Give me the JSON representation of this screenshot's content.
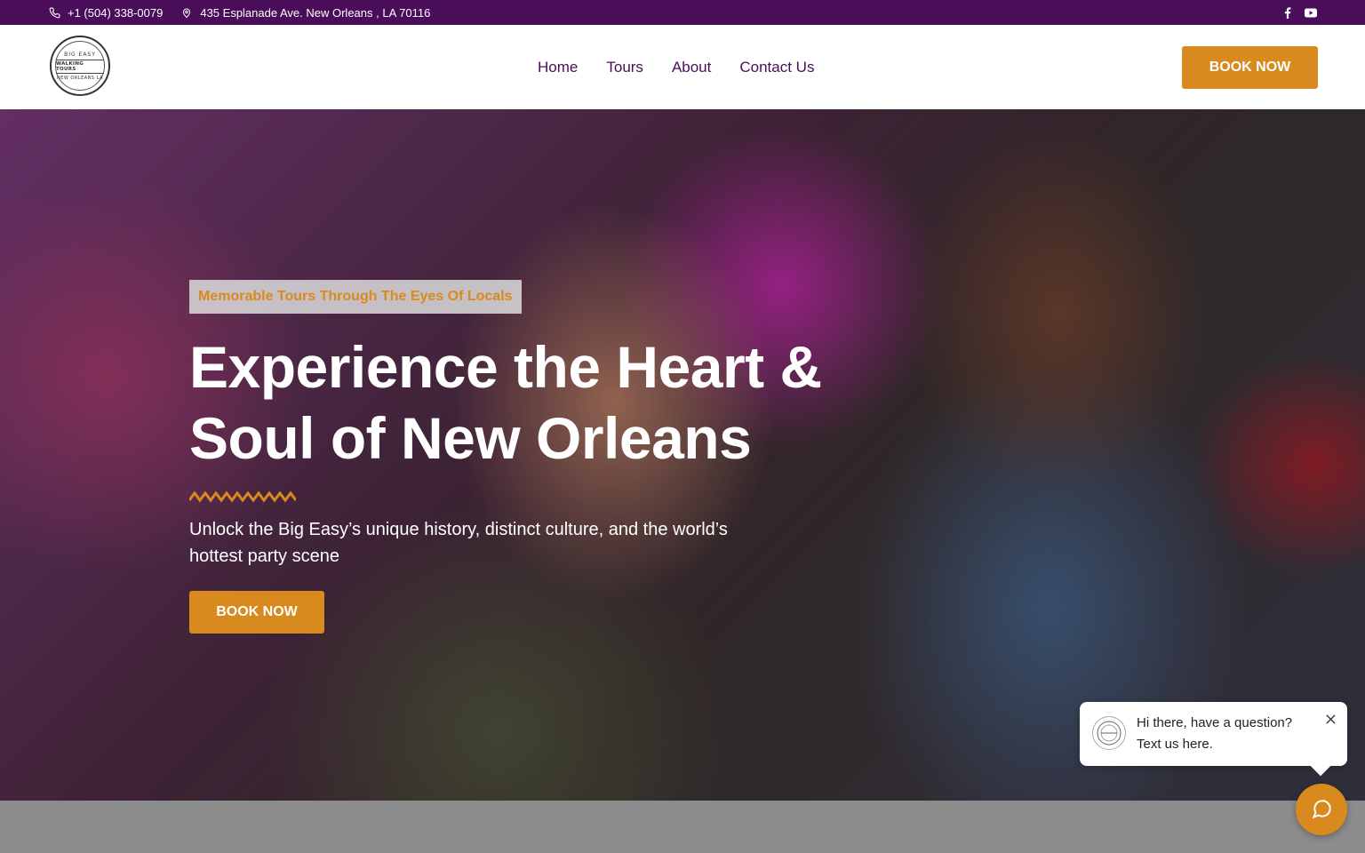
{
  "topbar": {
    "phone": "+1 (504) 338-0079",
    "address": "435 Esplanade Ave. New Orleans , LA 70116",
    "social": [
      "facebook-icon",
      "youtube-icon"
    ],
    "background": "#4a0d5a"
  },
  "header": {
    "logo": {
      "line1": "BIG EASY",
      "line2": "WALKING TOURS",
      "line3": "NEW ORLEANS LA"
    },
    "nav": [
      "Home",
      "Tours",
      "About",
      "Contact Us"
    ],
    "book_label": "BOOK NOW"
  },
  "hero": {
    "tagline": "Memorable Tours Through The Eyes Of Locals",
    "headline_line1": "Experience the Heart &",
    "headline_line2": "Soul of New Orleans",
    "subtitle": "Unlock the Big Easy’s unique history, distinct culture, and the world’s hottest party scene",
    "book_label": "BOOK NOW"
  },
  "chat": {
    "line1": "Hi there, have a question?",
    "line2": "Text us here."
  },
  "colors": {
    "accent": "#d98a1e",
    "brand_purple": "#4a0d5a"
  }
}
